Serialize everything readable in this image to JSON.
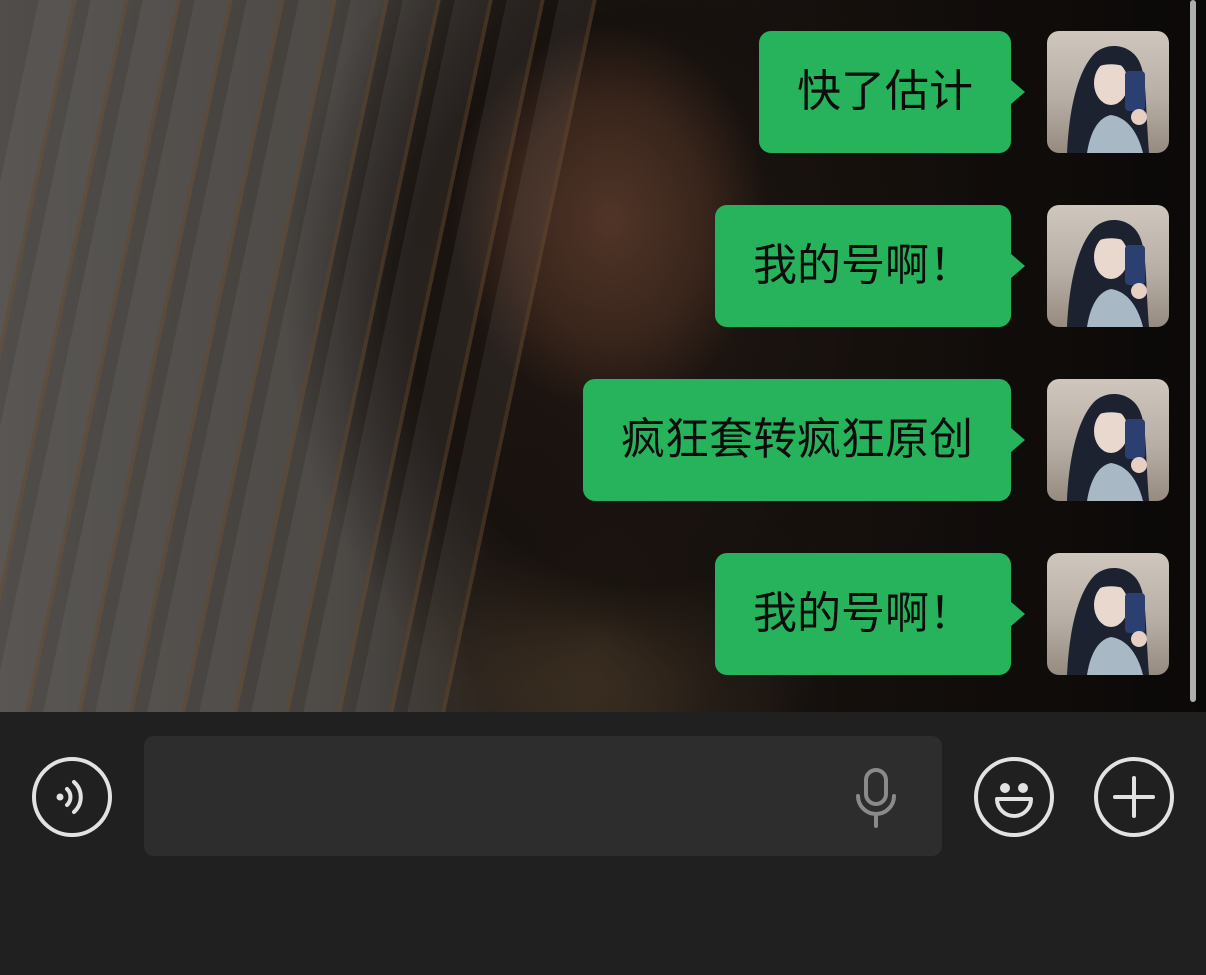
{
  "chat": {
    "messages": [
      {
        "sender": "me",
        "text": "快了估计"
      },
      {
        "sender": "me",
        "text": "我的号啊！"
      },
      {
        "sender": "me",
        "text": "疯狂套转疯狂原创"
      },
      {
        "sender": "me",
        "text": "我的号啊！"
      }
    ],
    "bubble_color": "#27b35c"
  },
  "input_bar": {
    "text_value": "",
    "voice_toggle_icon": "voice-wave-icon",
    "mic_icon": "microphone-icon",
    "emoji_icon": "smiley-face-icon",
    "plus_icon": "plus-icon"
  }
}
